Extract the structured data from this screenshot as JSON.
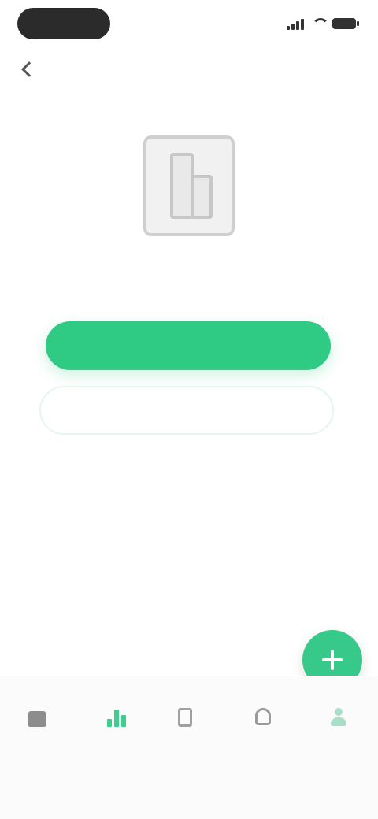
{
  "status_bar": {
    "time": "",
    "icons": [
      "signal-icon",
      "wifi-icon",
      "battery-icon"
    ]
  },
  "header": {
    "title": "",
    "action_label": "",
    "back_icon": "chevron-left-icon"
  },
  "empty_state": {
    "illustration": "document-icon",
    "message": "",
    "primary_button_label": "",
    "secondary_button_label": ""
  },
  "fab": {
    "icon": "plus-icon"
  },
  "bottom_nav": {
    "items": [
      {
        "icon": "home-icon",
        "label": "",
        "active": false
      },
      {
        "icon": "chart-icon",
        "label": "",
        "active": true
      },
      {
        "icon": "document-icon",
        "label": "",
        "active": false
      },
      {
        "icon": "bell-icon",
        "label": "",
        "active": false
      },
      {
        "icon": "user-icon",
        "label": "",
        "active": false
      }
    ]
  },
  "colors": {
    "accent": "#2fcb84",
    "accent_light": "#3ecf8e",
    "background": "#ffffff",
    "nav_background": "#fbfbfb"
  }
}
